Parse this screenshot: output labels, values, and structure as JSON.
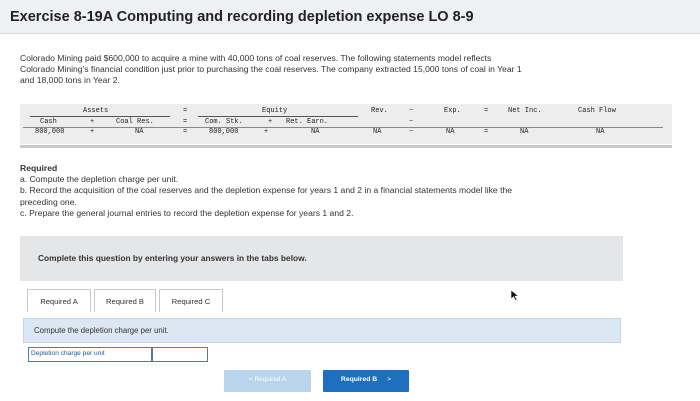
{
  "header": {
    "title": "Exercise 8-19A Computing and recording depletion expense LO 8-9"
  },
  "intro": {
    "line1": "Colorado Mining paid $600,000 to acquire a mine with 40,000 tons of coal reserves. The following statements model reflects",
    "line2": "Colorado Mining's financial condition just prior to purchasing the coal reserves. The company extracted 15,000 tons of coal in Year 1",
    "line3": "and 18,000 tons in Year 2."
  },
  "model": {
    "assets": "Assets",
    "equity": "Equity",
    "cash": "Cash",
    "coal_res": "Coal Res.",
    "com_stk": "Com. Stk.",
    "ret_earn": "Ret. Earn.",
    "rev": "Rev.",
    "exp": "Exp.",
    "net_inc": "Net Inc.",
    "cash_flow": "Cash Flow",
    "plus": "+",
    "equals": "=",
    "minus": "−",
    "cash_val": "800,000",
    "coal_val": "NA",
    "stk_val": "800,000",
    "earn_val": "NA",
    "rev_val": "NA",
    "exp_val": "NA",
    "net_val": "NA",
    "flow_val": "NA"
  },
  "required": {
    "heading": "Required",
    "a": "a. Compute the depletion charge per unit.",
    "b1": "b. Record the acquisition of the coal reserves and the depletion expense for years 1 and 2 in a financial statements model like the",
    "b2": "preceding one.",
    "c": "c. Prepare the general journal entries to record the depletion expense for years 1 and 2."
  },
  "instruction": "Complete this question by entering your answers in the tabs below.",
  "tabs": [
    {
      "label": "Required A"
    },
    {
      "label": "Required B"
    },
    {
      "label": "Required C"
    }
  ],
  "prompt": "Compute the depletion charge per unit.",
  "answer": {
    "label": "Depletion charge per unit",
    "value": ""
  },
  "nav": {
    "prev": "Required A",
    "prev_chevron": "<",
    "next": "Required B",
    "next_chevron": ">"
  }
}
